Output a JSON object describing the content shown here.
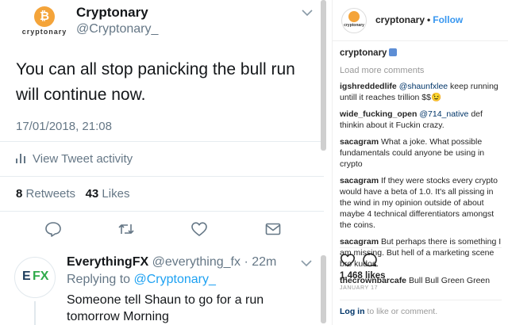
{
  "tweet": {
    "logo_word": "cryptonary",
    "name": "Cryptonary",
    "handle": "@Cryptonary_",
    "text": "You can all stop panicking the bull run will continue now.",
    "timestamp": "17/01/2018, 21:08",
    "activity_label": "View Tweet activity",
    "retweets_count": "8",
    "retweets_label": "Retweets",
    "likes_count": "43",
    "likes_label": "Likes"
  },
  "reply": {
    "avatar_text_a": "E",
    "avatar_text_b": "FX",
    "name": "EverythingFX",
    "handle_time": "@everything_fx · 22m",
    "replying_prefix": "Replying to",
    "replying_to": "@Cryptonary_",
    "text": "Someone tell Shaun to go for a run tomorrow Morning"
  },
  "instagram": {
    "username": "cryptonary",
    "dot": "•",
    "follow_label": "Follow",
    "avatar_word": "cryptonary",
    "caption_user": "cryptonary",
    "load_more": "Load more comments",
    "comments": [
      {
        "user": "igshreddedlife",
        "mention": "@shaunfxlee",
        "text": " keep running untill it reaches trillion $$😉"
      },
      {
        "user": "wide_fucking_open",
        "mention": "@714_native",
        "text": " def thinkin about it Fuckin crazy."
      },
      {
        "user": "sacagram",
        "mention": "",
        "text": " What a joke. What possible fundamentals could anyone be using in crypto"
      },
      {
        "user": "sacagram",
        "mention": "",
        "text": " If they were stocks every crypto would have a beta of 1.0. It's all pissing in the wind in my opinion outside of about maybe 4 technical differentiators amongst the coins."
      },
      {
        "user": "sacagram",
        "mention": "",
        "text": " But perhaps there is something I am missing. But hell of a marketing scene bro kudos."
      },
      {
        "user": "thecrownbarcafe",
        "mention": "",
        "text": " Bull Bull Green Green"
      }
    ],
    "likes": "1,468 likes",
    "date": "JANUARY 17",
    "login_link": "Log in",
    "login_rest": " to like or comment."
  },
  "colors": {
    "twitter_blue": "#1da1f2",
    "twitter_gray": "#657786",
    "ig_blue": "#3897f0",
    "ig_link": "#003569",
    "brand_orange": "#f4a43a",
    "efx_green": "#2eaa4a"
  }
}
